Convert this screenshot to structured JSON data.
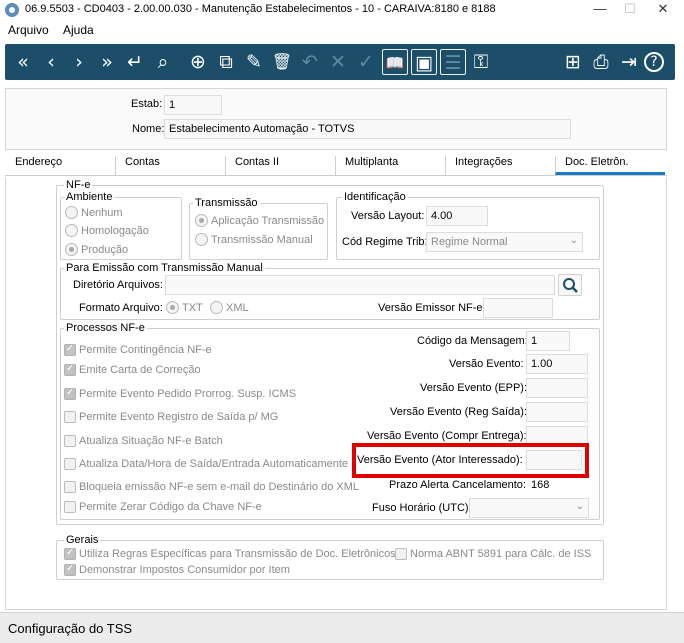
{
  "window": {
    "title": "06.9.5503 - CD0403 - 2.00.00.030 - Manutenção Estabelecimentos - 10 - CARAIVA:8180 e 8188",
    "minimize": "—",
    "maximize": "☐",
    "close": "✕"
  },
  "menu": {
    "items": [
      "Arquivo",
      "Ajuda"
    ]
  },
  "toolbar": {
    "icons": {
      "first": "«",
      "prev": "‹",
      "next": "›",
      "last": "»",
      "enter": "↵",
      "search": "⌕",
      "new": "⊕",
      "copy": "⧉",
      "edit": "✎",
      "delete": "🗑",
      "undo": "↶",
      "cancel": "✕",
      "confirm": "✓",
      "book": "📖",
      "screen": "▣",
      "filter": "☰",
      "key": "⚿",
      "tree": "⊞",
      "print": "⎙",
      "exit": "⇥",
      "help": "?"
    }
  },
  "header": {
    "estab_label": "Estab:",
    "estab_value": "1",
    "nome_label": "Nome:",
    "nome_value": "Estabelecimento Automação - TOTVS"
  },
  "tabs": [
    "Endereço",
    "Contas",
    "Contas II",
    "Multiplanta",
    "Integrações",
    "Doc. Eletrôn."
  ],
  "active_tab": "Doc. Eletrôn.",
  "nfe": {
    "title": "NF-e",
    "ambiente": {
      "title": "Ambiente",
      "options": [
        "Nenhum",
        "Homologação",
        "Produção"
      ],
      "selected": "Produção"
    },
    "transmissao": {
      "title": "Transmissão",
      "options": [
        "Aplicação Transmissão",
        "Transmissão Manual"
      ],
      "selected": "Aplicação Transmissão"
    },
    "identificacao": {
      "title": "Identificação",
      "versao_layout_label": "Versão Layout:",
      "versao_layout_value": "4.00",
      "cod_regime_label": "Cód Regime Trib:",
      "cod_regime_value": "Regime Normal"
    },
    "emissao_manual": {
      "title": "Para Emissão com Transmissão Manual",
      "diretorio_label": "Diretório Arquivos:",
      "diretorio_value": "",
      "formato_label": "Formato Arquivo:",
      "formato_options": [
        "TXT",
        "XML"
      ],
      "formato_selected": "TXT",
      "versao_emissor_label": "Versão Emissor NF-e:",
      "versao_emissor_value": ""
    },
    "processos": {
      "title": "Processos NF-e",
      "checks": [
        {
          "label": "Permite Contingência NF-e",
          "checked": true
        },
        {
          "label": "Emite Carta de Correção",
          "checked": true
        },
        {
          "label": "Permite Evento Pedido Prorrog. Susp. ICMS",
          "checked": true
        },
        {
          "label": "Permite Evento Registro de Saída p/ MG",
          "checked": false
        },
        {
          "label": "Atualiza Situação NF-e Batch",
          "checked": false
        },
        {
          "label": "Atualiza Data/Hora de Saída/Entrada Automaticamente",
          "checked": false
        },
        {
          "label": "Bloqueia emissão NF-e sem e-mail do Destinário do XML",
          "checked": false
        },
        {
          "label": "Permite Zerar Código da Chave NF-e",
          "checked": false
        }
      ],
      "fields": [
        {
          "label": "Código da Mensagem:",
          "value": "1"
        },
        {
          "label": "Versão Evento:",
          "value": "1.00"
        },
        {
          "label": "Versão Evento (EPP):",
          "value": ""
        },
        {
          "label": "Versão Evento (Reg Saída):",
          "value": ""
        },
        {
          "label": "Versão Evento (Compr Entrega):",
          "value": ""
        },
        {
          "label": "Versão Evento (Ator Interessado):",
          "value": ""
        },
        {
          "label": "Prazo Alerta Cancelamento:",
          "value": "168"
        },
        {
          "label": "Fuso Horário (UTC):",
          "value": ""
        }
      ]
    }
  },
  "gerais": {
    "title": "Gerais",
    "checks": [
      {
        "label": "Utiliza Regras Específicas para Transmissão de Doc. Eletrônicos",
        "checked": true
      },
      {
        "label": "Norma ABNT 5891 para Cálc. de ISS",
        "checked": false
      },
      {
        "label": "Demonstrar Impostos Consumidor por Item",
        "checked": true
      }
    ]
  },
  "status": {
    "text": "Configuração do TSS"
  },
  "colors": {
    "toolbar": "#1c4e6a",
    "tab_accent": "#1a7cc7",
    "highlight": "#e00000"
  }
}
